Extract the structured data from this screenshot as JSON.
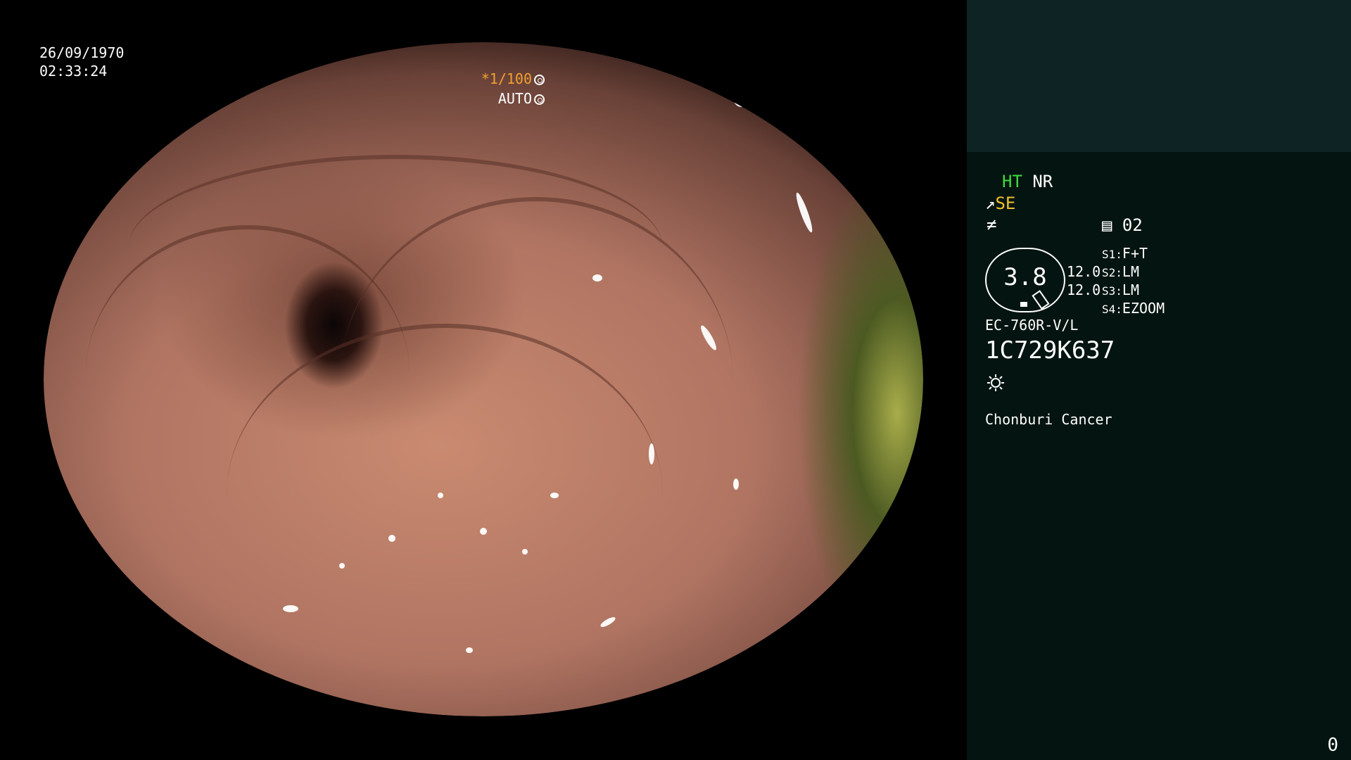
{
  "overlay": {
    "date": "26/09/1970",
    "time": "02:33:24",
    "shutter": "*1/100",
    "iris": "AUTO"
  },
  "panel": {
    "ht_label": "HT",
    "nr_label": "NR",
    "se_label": "SE",
    "memory_label": "02",
    "zoom_value": "3.8",
    "zoom_sub1": "12.0",
    "zoom_sub2": "12.0",
    "switches": [
      {
        "key": "S1:",
        "value": "F+T"
      },
      {
        "key": "S2:",
        "value": "LM"
      },
      {
        "key": "S3:",
        "value": "LM"
      },
      {
        "key": "S4:",
        "value": "EZOOM"
      }
    ],
    "scope_model": "EC-760R-V/L",
    "serial": "1C729K637",
    "institution": "Chonburi Cancer",
    "page_number": "0"
  },
  "icons": {
    "shutter_icon": "aperture-icon",
    "iris_icon": "iris-icon",
    "memory_icon": "memory-icon",
    "light_icon": "sun-icon"
  },
  "colors": {
    "panel_bg": "#041410",
    "panel_top": "#0e2424",
    "ht_green": "#3cdc3c",
    "se_yellow": "#f0c030",
    "shutter_orange": "#f0a030"
  }
}
